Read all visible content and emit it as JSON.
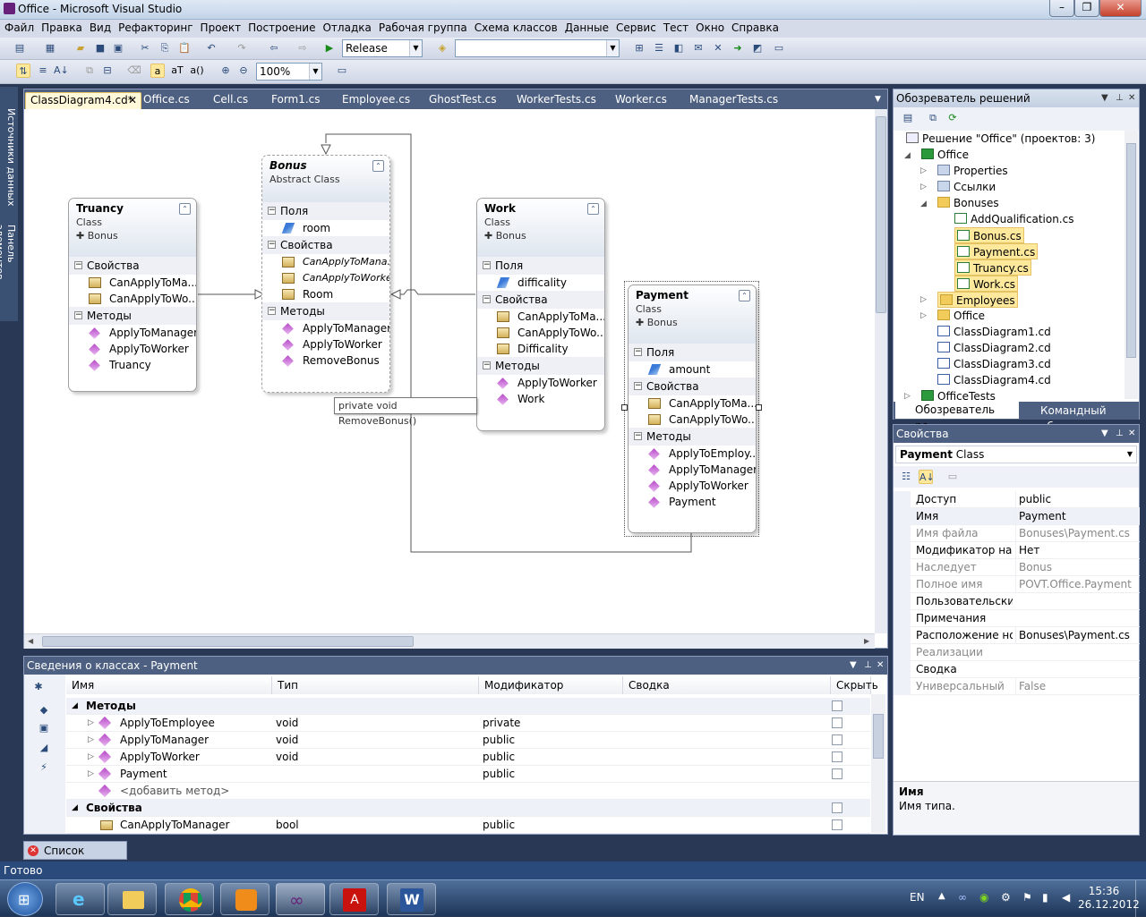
{
  "window": {
    "title": "Office - Microsoft Visual Studio"
  },
  "menu": [
    "Файл",
    "Правка",
    "Вид",
    "Рефакторинг",
    "Проект",
    "Построение",
    "Отладка",
    "Рабочая группа",
    "Схема классов",
    "Данные",
    "Сервис",
    "Тест",
    "Окно",
    "Справка"
  ],
  "toolbar": {
    "config": "Release",
    "platform": "",
    "zoom": "100%"
  },
  "side_tabs": [
    "Источники данных",
    "Панель элементов"
  ],
  "doc_tabs": [
    "ClassDiagram4.cd*",
    "Office.cs",
    "Cell.cs",
    "Form1.cs",
    "Employee.cs",
    "GhostTest.cs",
    "WorkerTests.cs",
    "Worker.cs",
    "ManagerTests.cs"
  ],
  "diagram": {
    "truancy": {
      "name": "Truancy",
      "stereotype": "Class",
      "base": "Bonus",
      "sec_props": "Свойства",
      "props": [
        "CanApplyToMa...",
        "CanApplyToWo..."
      ],
      "sec_methods": "Методы",
      "methods": [
        "ApplyToManager",
        "ApplyToWorker",
        "Truancy"
      ]
    },
    "bonus": {
      "name": "Bonus",
      "stereotype": "Abstract Class",
      "sec_fields": "Поля",
      "fields": [
        "room"
      ],
      "sec_props": "Свойства",
      "props": [
        "CanApplyToMana...",
        "CanApplyToWorker",
        "Room"
      ],
      "sec_methods": "Методы",
      "methods": [
        "ApplyToManager",
        "ApplyToWorker",
        "RemoveBonus"
      ]
    },
    "work": {
      "name": "Work",
      "stereotype": "Class",
      "base": "Bonus",
      "sec_fields": "Поля",
      "fields": [
        "difficality"
      ],
      "sec_props": "Свойства",
      "props": [
        "CanApplyToMa...",
        "CanApplyToWo...",
        "Difficality"
      ],
      "sec_methods": "Методы",
      "methods": [
        "ApplyToWorker",
        "Work"
      ]
    },
    "payment": {
      "name": "Payment",
      "stereotype": "Class",
      "base": "Bonus",
      "sec_fields": "Поля",
      "fields": [
        "amount"
      ],
      "sec_props": "Свойства",
      "props": [
        "CanApplyToMa...",
        "CanApplyToWo..."
      ],
      "sec_methods": "Методы",
      "methods": [
        "ApplyToEmploy...",
        "ApplyToManager",
        "ApplyToWorker",
        "Payment"
      ]
    },
    "tooltip": "private void RemoveBonus()"
  },
  "solution": {
    "title": "Обозреватель решений",
    "items": [
      "Решение \"Office\"  (проектов: 3)",
      "Office",
      "Properties",
      "Ссылки",
      "Bonuses",
      "AddQualification.cs",
      "Bonus.cs",
      "Payment.cs",
      "Truancy.cs",
      "Work.cs",
      "Employees",
      "Office",
      "ClassDiagram1.cd",
      "ClassDiagram2.cd",
      "ClassDiagram3.cd",
      "ClassDiagram4.cd",
      "OfficeTests"
    ],
    "tab1": "Обозреватель ре...",
    "tab2": "Командный обоз..."
  },
  "properties": {
    "title": "Свойства",
    "object": "Payment",
    "object_type": "Class",
    "rows": [
      [
        "Доступ",
        "public"
      ],
      [
        "Имя",
        "Payment"
      ],
      [
        "Имя файла",
        "Bonuses\\Payment.cs"
      ],
      [
        "Модификатор насл",
        "Нет"
      ],
      [
        "Наследует",
        "Bonus"
      ],
      [
        "Полное имя",
        "POVT.Office.Payment"
      ],
      [
        "Пользовательские",
        ""
      ],
      [
        "Примечания",
        ""
      ],
      [
        "Расположение нов",
        "Bonuses\\Payment.cs"
      ],
      [
        "Реализации",
        ""
      ],
      [
        "Сводка",
        ""
      ],
      [
        "Универсальный",
        "False"
      ]
    ],
    "desc_title": "Имя",
    "desc_text": "Имя типа."
  },
  "details": {
    "title": "Сведения о классах - Payment",
    "cols": [
      "Имя",
      "Тип",
      "Модификатор",
      "Сводка",
      "Скрыть"
    ],
    "group_methods": "Методы",
    "rows": [
      [
        "ApplyToEmployee",
        "void",
        "private"
      ],
      [
        "ApplyToManager",
        "void",
        "public"
      ],
      [
        "ApplyToWorker",
        "void",
        "public"
      ],
      [
        "Payment",
        "",
        "public"
      ]
    ],
    "add_method": "<добавить метод>",
    "group_props": "Свойства",
    "prop_row": [
      "CanApplyToManager",
      "bool",
      "public"
    ]
  },
  "error_tab": "Список ошибок",
  "status": "Готово",
  "tray": {
    "lang": "EN",
    "time": "15:36",
    "date": "26.12.2012"
  }
}
